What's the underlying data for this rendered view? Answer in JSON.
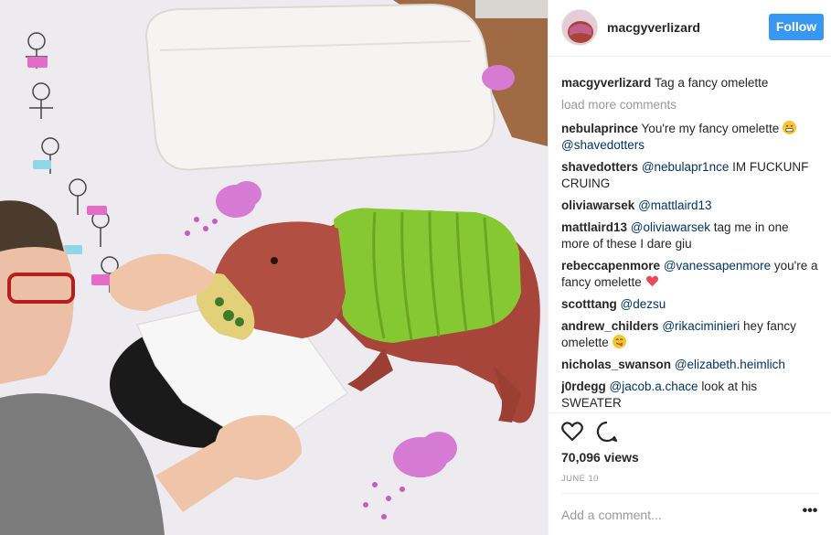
{
  "post": {
    "username": "macgyverlizard",
    "follow_label": "Follow",
    "caption_user": "macgyverlizard",
    "caption_text": "Tag a fancy omelette",
    "load_more": "load more comments",
    "views": "70,096 views",
    "date": "JUNE 10",
    "comment_placeholder": "Add a comment...",
    "more_label": "•••"
  },
  "comments": [
    {
      "user": "nebulaprince",
      "mention_first": "",
      "text": "You're my fancy omelette",
      "emoji": "grimace",
      "mention_after": "@shavedotters"
    },
    {
      "user": "shavedotters",
      "mention_first": "@nebulapr1nce",
      "text": "IM FUCKUNF CRUING",
      "emoji": "",
      "mention_after": ""
    },
    {
      "user": "oliviawarsek",
      "mention_first": "@mattlaird13",
      "text": "",
      "emoji": "",
      "mention_after": ""
    },
    {
      "user": "mattlaird13",
      "mention_first": "@oliviawarsek",
      "text": "tag me in one more of these I dare giu",
      "emoji": "",
      "mention_after": ""
    },
    {
      "user": "rebeccapenmore",
      "mention_first": "@vanessapenmore",
      "text": "you're a fancy omelette",
      "emoji": "heart",
      "mention_after": ""
    },
    {
      "user": "scotttang",
      "mention_first": "@dezsu",
      "text": "",
      "emoji": "",
      "mention_after": ""
    },
    {
      "user": "andrew_childers",
      "mention_first": "@rikaciminieri",
      "text": "hey fancy omelette",
      "emoji": "yum",
      "mention_after": ""
    },
    {
      "user": "nicholas_swanson",
      "mention_first": "@elizabeth.heimlich",
      "text": "",
      "emoji": "",
      "mention_after": ""
    },
    {
      "user": "j0rdegg",
      "mention_first": "@jacob.a.chace",
      "text": "look at his SWEATER",
      "emoji": "",
      "mention_after": ""
    }
  ],
  "icons": {
    "like": "heart-outline-icon",
    "comment": "speech-bubble-icon",
    "more": "ellipsis-icon"
  },
  "colors": {
    "accent": "#3897f0",
    "mention": "#003569",
    "muted": "#999999",
    "heart": "#ed4956",
    "sweater": "#86c832",
    "lizard": "#a8453a"
  }
}
